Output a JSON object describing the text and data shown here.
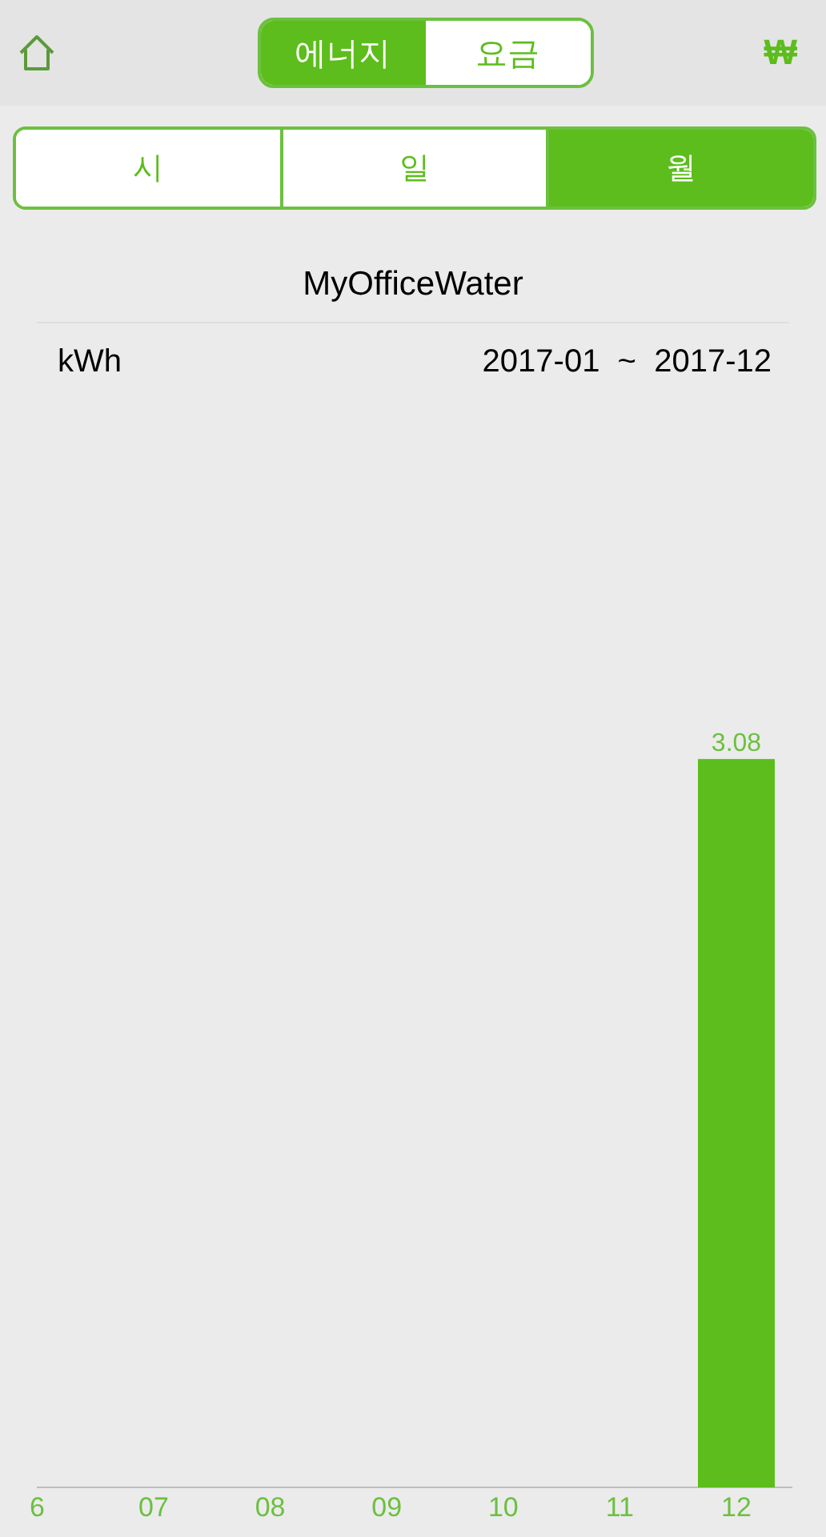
{
  "header": {
    "segments": [
      {
        "label": "에너지",
        "selected": true
      },
      {
        "label": "요금",
        "selected": false
      }
    ],
    "currency": "₩"
  },
  "periods": [
    {
      "label": "시",
      "selected": false
    },
    {
      "label": "일",
      "selected": false
    },
    {
      "label": "월",
      "selected": true
    }
  ],
  "meter_name": "MyOfficeWater",
  "unit": "kWh",
  "range": "2017-01  ~  2017-12",
  "chart_data": {
    "type": "bar",
    "categories": [
      "6",
      "07",
      "08",
      "09",
      "10",
      "11",
      "12"
    ],
    "series": [
      {
        "color": "#5cbd1c",
        "values": [
          null,
          null,
          null,
          null,
          null,
          null,
          3.08
        ]
      }
    ],
    "data_labels": true
  }
}
